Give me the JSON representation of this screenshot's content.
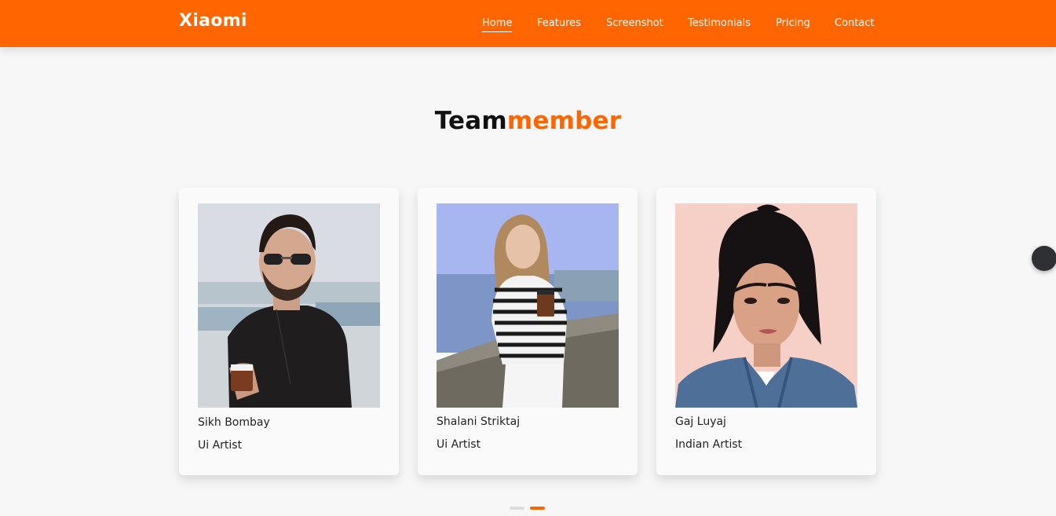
{
  "header": {
    "brand": "Xiaomi",
    "nav": [
      {
        "label": "Home",
        "active": true
      },
      {
        "label": "Features"
      },
      {
        "label": "Screenshot"
      },
      {
        "label": "Testimonials"
      },
      {
        "label": "Pricing"
      },
      {
        "label": "Contact"
      }
    ]
  },
  "section": {
    "title_main": "Team",
    "title_accent": "member"
  },
  "team": [
    {
      "name": "Sikh Bombay",
      "role": "Ui Artist"
    },
    {
      "name": "Shalani Striktaj",
      "role": "Ui Artist"
    },
    {
      "name": "Gaj Luyaj",
      "role": "Indian Artist"
    }
  ],
  "carousel": {
    "pages": 2,
    "active_page": 2
  },
  "colors": {
    "accent": "#ff6600",
    "background": "#f7f7f7",
    "card": "#fafafa",
    "scroll_button": "#2f3033"
  }
}
